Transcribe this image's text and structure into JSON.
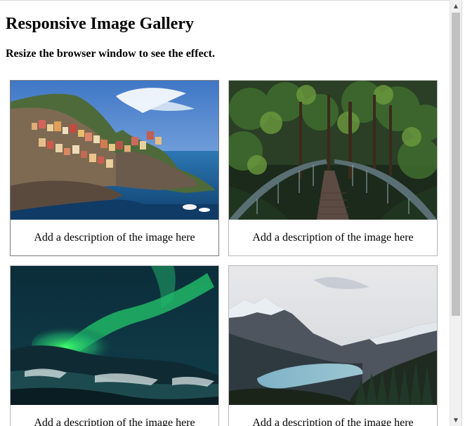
{
  "page": {
    "heading": "Responsive Image Gallery",
    "subheading": "Resize the browser window to see the effect."
  },
  "gallery": [
    {
      "image": "cinque-terre-coastal-village",
      "description": "Add a description of the image here"
    },
    {
      "image": "forest-bridge",
      "description": "Add a description of the image here"
    },
    {
      "image": "northern-lights",
      "description": "Add a description of the image here"
    },
    {
      "image": "mountain-lake",
      "description": "Add a description of the image here"
    }
  ],
  "scrollbar": {
    "up_icon": "arrow-up-icon",
    "down_icon": "arrow-down-icon",
    "up_glyph": "▲",
    "down_glyph": "▼"
  }
}
